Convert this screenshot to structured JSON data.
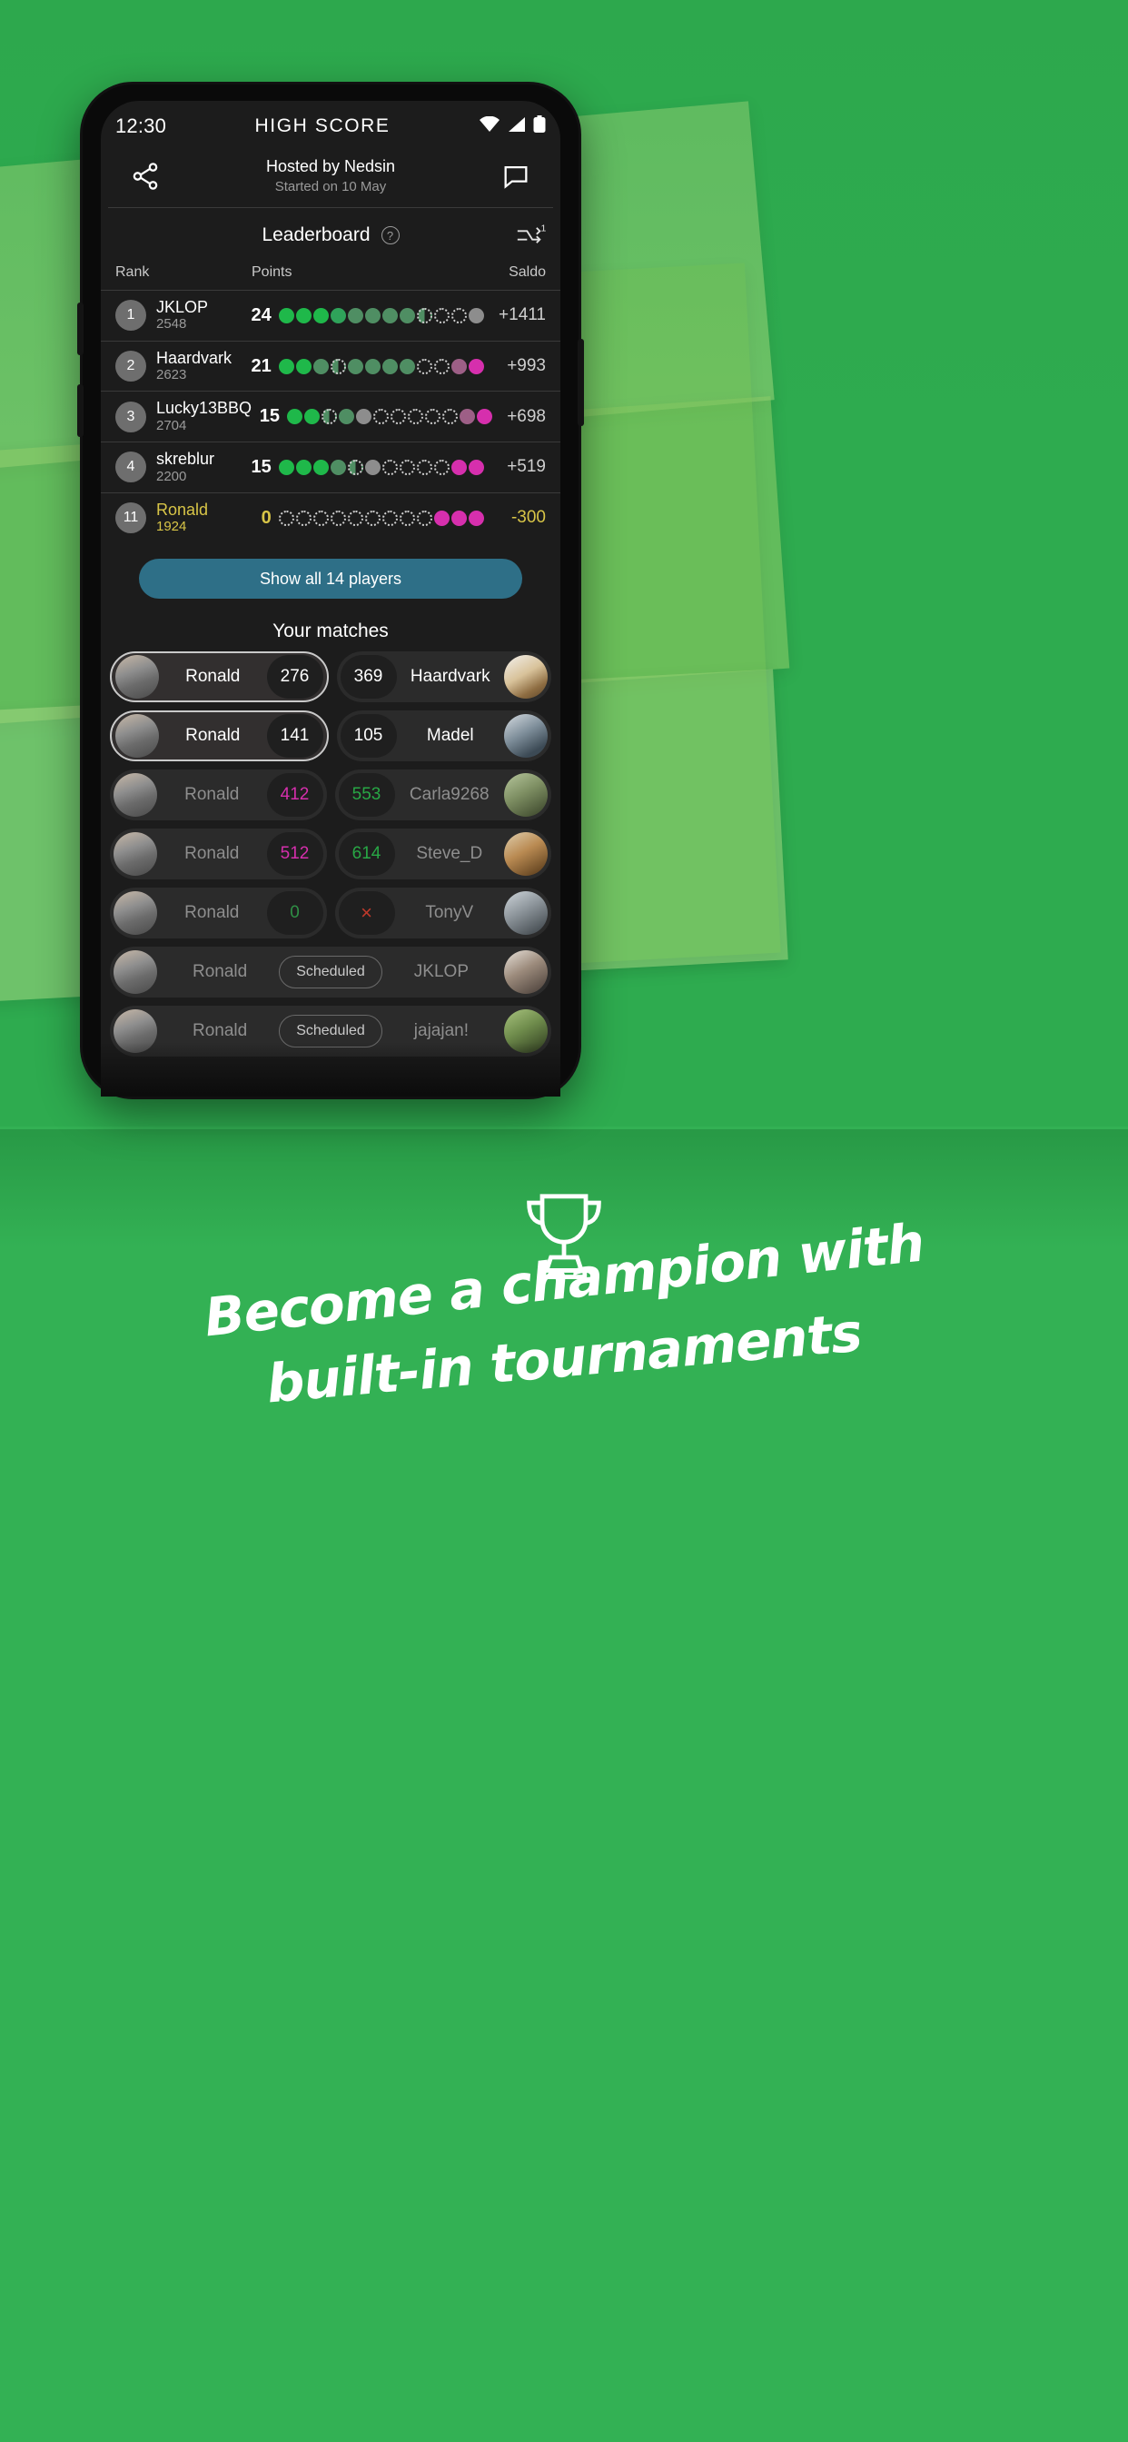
{
  "statusbar": {
    "time": "12:30",
    "title": "HIGH SCORE",
    "icons": [
      "wifi-icon",
      "signal-icon",
      "battery-icon"
    ]
  },
  "header": {
    "share_icon": "share-icon",
    "chat_icon": "chat-icon",
    "hosted_by": "Hosted by Nedsin",
    "started_on": "Started on 10 May"
  },
  "leaderboard_tab": {
    "label": "Leaderboard",
    "help_icon": "help-icon",
    "help_glyph": "?",
    "shuffle_icon": "shuffle-repeat-icon",
    "shuffle_badge": "1"
  },
  "columns": {
    "rank": "Rank",
    "points": "Points",
    "saldo": "Saldo"
  },
  "rows": [
    {
      "rank": "1",
      "name": "JKLOP",
      "sub": "2548",
      "points": "24",
      "saldo": "+1411",
      "me": false,
      "dots": [
        "g1",
        "g1",
        "g1",
        "g2",
        "g3",
        "g3",
        "g3",
        "g3",
        "hf",
        "em",
        "em",
        "gr"
      ]
    },
    {
      "rank": "2",
      "name": "Haardvark",
      "sub": "2623",
      "points": "21",
      "saldo": "+993",
      "me": false,
      "dots": [
        "g1",
        "g1",
        "g3",
        "hf",
        "g3",
        "g3",
        "g3",
        "g3",
        "em",
        "em",
        "pk2",
        "pk"
      ]
    },
    {
      "rank": "3",
      "name": "Lucky13BBQ",
      "sub": "2704",
      "points": "15",
      "saldo": "+698",
      "me": false,
      "dots": [
        "g1",
        "g1",
        "hf",
        "g3",
        "gr",
        "em",
        "em",
        "em",
        "em",
        "em",
        "pk2",
        "pk"
      ]
    },
    {
      "rank": "4",
      "name": "skreblur",
      "sub": "2200",
      "points": "15",
      "saldo": "+519",
      "me": false,
      "dots": [
        "g1",
        "g1",
        "g1",
        "g3",
        "hf",
        "gr",
        "em",
        "em",
        "em",
        "em",
        "pk",
        "pk"
      ]
    },
    {
      "rank": "11",
      "name": "Ronald",
      "sub": "1924",
      "points": "0",
      "saldo": "-300",
      "me": true,
      "dots": [
        "em",
        "em",
        "em",
        "em",
        "em",
        "em",
        "em",
        "em",
        "em",
        "pk",
        "pk",
        "pk"
      ]
    }
  ],
  "show_all": {
    "label": "Show all 14 players"
  },
  "matches": {
    "title": "Your matches",
    "scheduled_label": "Scheduled",
    "cross_glyph": "×",
    "items": [
      {
        "left_name": "Ronald",
        "left_score": "276",
        "left_avatar": "cat-avatar",
        "right_score": "369",
        "right_name": "Haardvark",
        "right_avatar": "aardvark-avatar",
        "selected": true,
        "dim": false,
        "scheduled": false,
        "left_score_style": "",
        "right_score_style": ""
      },
      {
        "left_name": "Ronald",
        "left_score": "141",
        "left_avatar": "cat-avatar",
        "right_score": "105",
        "right_name": "Madel",
        "right_avatar": "madel-avatar",
        "selected": true,
        "dim": false,
        "scheduled": false,
        "left_score_style": "",
        "right_score_style": ""
      },
      {
        "left_name": "Ronald",
        "left_score": "412",
        "left_avatar": "cat-avatar",
        "right_score": "553",
        "right_name": "Carla9268",
        "right_avatar": "carla-avatar",
        "selected": false,
        "dim": true,
        "scheduled": false,
        "left_score_style": "pink",
        "right_score_style": "green"
      },
      {
        "left_name": "Ronald",
        "left_score": "512",
        "left_avatar": "cat-avatar",
        "right_score": "614",
        "right_name": "Steve_D",
        "right_avatar": "steve-avatar",
        "selected": false,
        "dim": true,
        "scheduled": false,
        "left_score_style": "pink",
        "right_score_style": "green"
      },
      {
        "left_name": "Ronald",
        "left_score": "0",
        "left_avatar": "cat-avatar",
        "right_score": "×",
        "right_name": "TonyV",
        "right_avatar": "tony-avatar",
        "selected": false,
        "dim": true,
        "scheduled": false,
        "left_score_style": "zero",
        "right_score_style": "x"
      },
      {
        "left_name": "Ronald",
        "left_score": "",
        "left_avatar": "cat-avatar",
        "right_score": "",
        "right_name": "JKLOP",
        "right_avatar": "jklop-avatar",
        "selected": false,
        "dim": true,
        "scheduled": true,
        "left_score_style": "",
        "right_score_style": ""
      },
      {
        "left_name": "Ronald",
        "left_score": "",
        "left_avatar": "cat-avatar",
        "right_score": "",
        "right_name": "jajajan!",
        "right_avatar": "jajajan-avatar",
        "selected": false,
        "dim": true,
        "scheduled": true,
        "left_score_style": "",
        "right_score_style": ""
      }
    ]
  },
  "promo": {
    "trophy_icon": "trophy-icon",
    "line1": "Become a champion with",
    "line2": "built-in tournaments"
  },
  "colors": {
    "background_green": "#2eab4f",
    "accent_blue": "#2e6f87",
    "highlight_yellow": "#d8c547",
    "pink": "#d62fad",
    "green_dot": "#1fb84a"
  }
}
